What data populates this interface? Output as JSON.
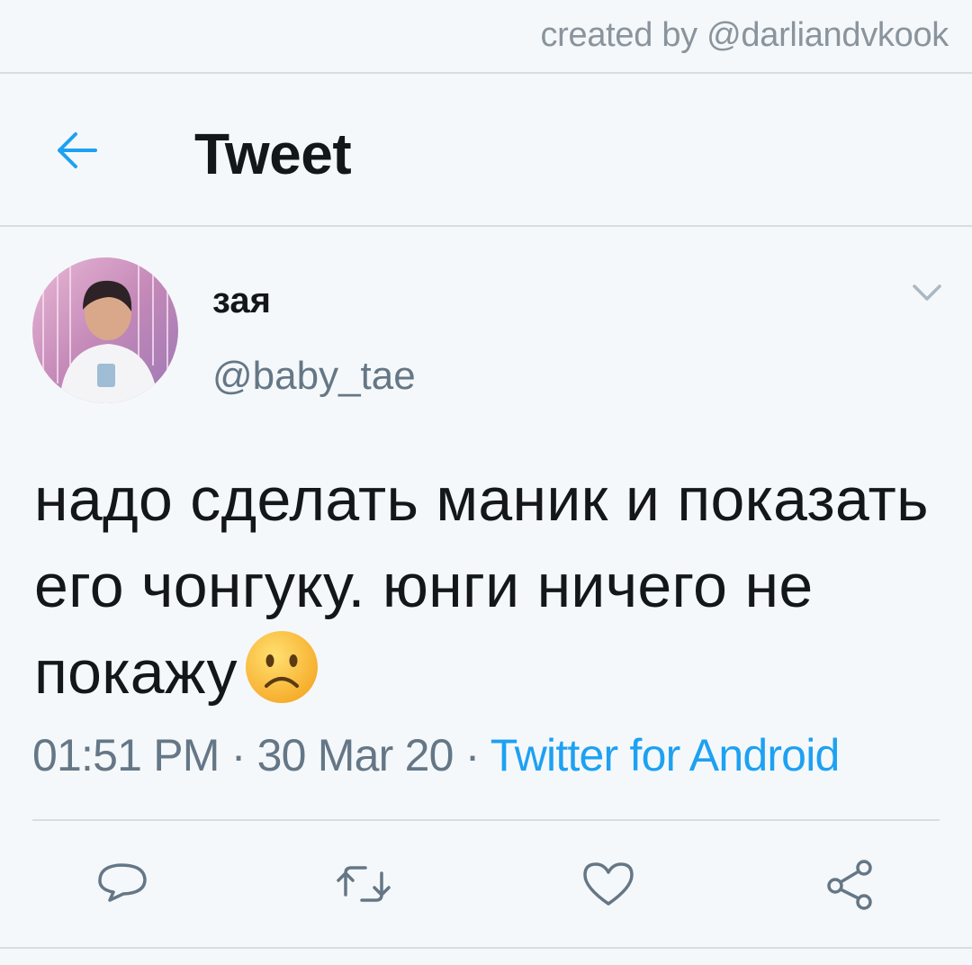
{
  "watermark": {
    "text": "created by @darliandvkook"
  },
  "header": {
    "back_icon": "arrow-left-icon",
    "title": "Tweet"
  },
  "tweet": {
    "display_name": "зая",
    "handle": "@baby_tae",
    "text": "надо сделать маник и показать его чонгуку. юнги ничего не покажу",
    "emoji": "frowning-face-emoji",
    "time": "01:51 PM",
    "separator": " · ",
    "date": "30 Mar 20",
    "source": "Twitter for Android"
  },
  "actions": [
    {
      "icon": "reply-icon"
    },
    {
      "icon": "retweet-icon"
    },
    {
      "icon": "like-icon"
    },
    {
      "icon": "share-icon"
    }
  ],
  "colors": {
    "accent": "#1da1f2",
    "text": "#14171a",
    "secondary": "#657786",
    "background": "#f5f8fa",
    "divider": "#d8dde2"
  }
}
